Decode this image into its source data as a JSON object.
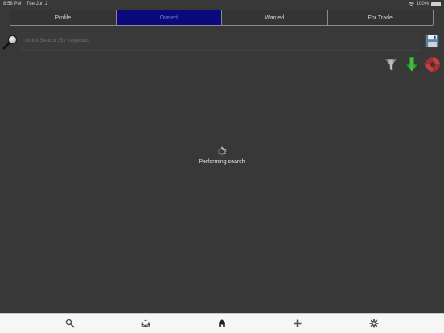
{
  "status_bar": {
    "time": "8:58 PM",
    "date": "Tue Jun 2",
    "battery": "100%",
    "wifi_icon": "wifi-icon",
    "battery_icon": "battery-icon"
  },
  "segments": [
    {
      "label": "Profile",
      "active": false
    },
    {
      "label": "Owned",
      "active": true
    },
    {
      "label": "Wanted",
      "active": false
    },
    {
      "label": "For Trade",
      "active": false
    }
  ],
  "search": {
    "placeholder": "Quick Search (By Keyword)",
    "value": "",
    "search_icon": "magnifier-icon",
    "save_icon": "floppy-disk-icon"
  },
  "toolbar": {
    "filter_icon": "funnel-icon",
    "download_icon": "down-arrow-icon",
    "help_icon": "lifebuoy-icon"
  },
  "loading": {
    "text": "Performing search",
    "icon": "spinner-icon"
  },
  "tab_bar": {
    "items": [
      {
        "icon": "search-icon"
      },
      {
        "icon": "mail-open-icon"
      },
      {
        "icon": "home-icon"
      },
      {
        "icon": "plus-icon"
      },
      {
        "icon": "gear-icon"
      }
    ]
  },
  "colors": {
    "background": "#383838",
    "active_segment": "#0a0a7c",
    "filter": "#808080",
    "download": "#2e9a2e",
    "help": "#d23a3a",
    "tab_bar_bg": "#f6f6f6"
  }
}
